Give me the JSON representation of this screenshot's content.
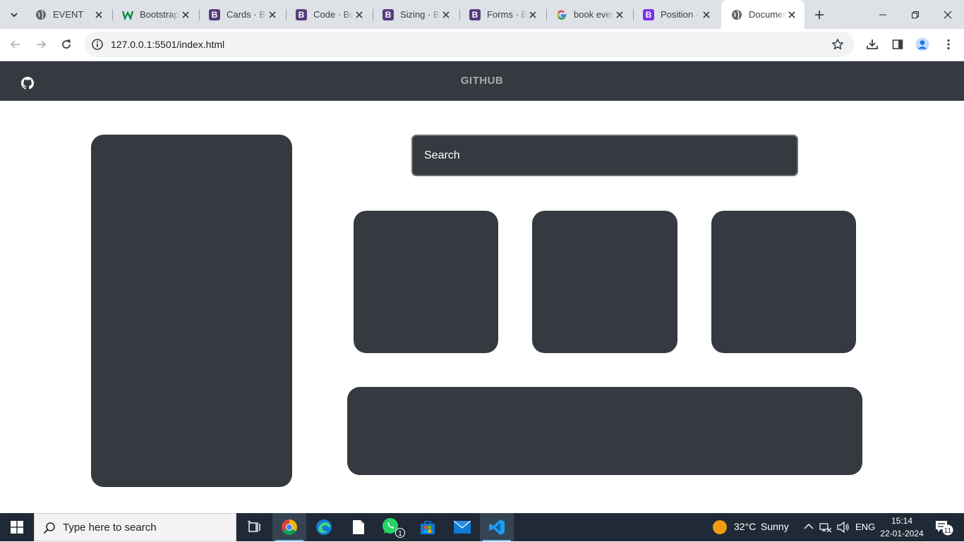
{
  "browser": {
    "tabs": [
      {
        "title": "EVENT",
        "icon": "globe-icon"
      },
      {
        "title": "Bootstrap",
        "icon": "w-icon"
      },
      {
        "title": "Cards · Bo",
        "icon": "bootstrap-icon"
      },
      {
        "title": "Code · Bo",
        "icon": "bootstrap-icon"
      },
      {
        "title": "Sizing · Bo",
        "icon": "bootstrap-icon"
      },
      {
        "title": "Forms · Bo",
        "icon": "bootstrap-icon"
      },
      {
        "title": "book even",
        "icon": "google-icon"
      },
      {
        "title": "Position ·",
        "icon": "bootstrap-icon"
      },
      {
        "title": "Documen",
        "icon": "globe-icon",
        "active": true
      }
    ],
    "url": "127.0.0.1:5501/index.html"
  },
  "page": {
    "navbar": {
      "brand": "GITHUB",
      "logo_icon": "github-icon"
    },
    "search": {
      "placeholder": "Search"
    },
    "colors": {
      "panel": "#343a40",
      "navbar": "#343a40",
      "background": "#ffffff"
    }
  },
  "taskbar": {
    "search_placeholder": "Type here to search",
    "weather": {
      "temp": "32°C",
      "condition": "Sunny"
    },
    "language": "ENG",
    "time": "15:14",
    "date": "22-01-2024",
    "notification_count": "11",
    "whatsapp_badge": "1"
  }
}
